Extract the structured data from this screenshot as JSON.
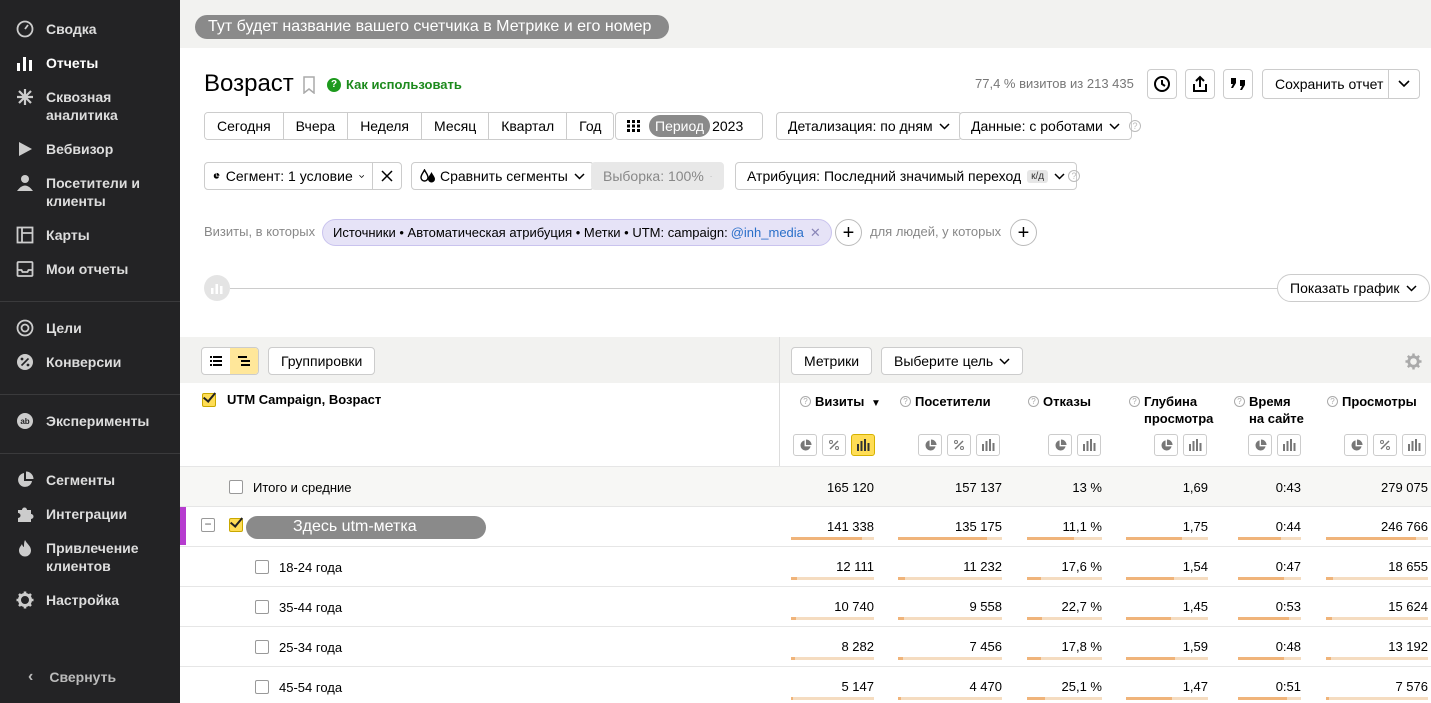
{
  "sidebar": {
    "items": [
      {
        "label": "Сводка",
        "icon": "dashboard-icon"
      },
      {
        "label": "Отчеты",
        "icon": "reports-icon"
      },
      {
        "label": "Сквозная аналитика",
        "icon": "end-to-end-icon"
      },
      {
        "label": "Вебвизор",
        "icon": "play-icon"
      },
      {
        "label": "Посетители и клиенты",
        "icon": "person-icon"
      },
      {
        "label": "Карты",
        "icon": "map-icon"
      },
      {
        "label": "Мои отчеты",
        "icon": "inbox-icon"
      },
      {
        "label": "Цели",
        "icon": "target-icon"
      },
      {
        "label": "Конверсии",
        "icon": "percent-icon"
      },
      {
        "label": "Эксперименты",
        "icon": "ab-icon"
      },
      {
        "label": "Сегменты",
        "icon": "pie-icon"
      },
      {
        "label": "Интеграции",
        "icon": "puzzle-icon"
      },
      {
        "label": "Привлечение клиентов",
        "icon": "fire-icon"
      },
      {
        "label": "Настройка",
        "icon": "gear-icon"
      }
    ],
    "active_index": 1,
    "collapse_label": "Свернуть"
  },
  "topbar": {
    "counter_placeholder": "Тут будет название вашего счетчика в Метрике и его номер"
  },
  "header": {
    "title": "Возраст",
    "howto_label": "Как использовать",
    "visits_info": "77,4 % визитов из 213 435",
    "save_label": "Сохранить отчет"
  },
  "periods": [
    "Сегодня",
    "Вчера",
    "Неделя",
    "Месяц",
    "Квартал",
    "Год"
  ],
  "controls": {
    "period_pill": "Период",
    "period_tail": "2023",
    "detail": "Детализация: по дням",
    "data": "Данные: с роботами",
    "segment": "Сегмент: 1 условие",
    "compare": "Сравнить сегменты",
    "sample": "Выборка: 100%",
    "attribution": "Атрибуция: Последний значимый переход",
    "attribution_badge": "к/д"
  },
  "filters": {
    "visits_label": "Визиты, в которых",
    "chip_text": "Источники • Автоматическая атрибуция • Метки • UTM: campaign:",
    "chip_link": "@inh_media",
    "people_label": "для людей, у которых"
  },
  "graph": {
    "show_label": "Показать график"
  },
  "table": {
    "groupings_label": "Группировки",
    "metrics_label": "Метрики",
    "goal_label": "Выберите цель",
    "dimension_header": "UTM Campaign, Возраст",
    "columns": [
      {
        "line1": "Визиты",
        "line2": "",
        "sort": "▼"
      },
      {
        "line1": "Посетители",
        "line2": "",
        "sort": ""
      },
      {
        "line1": "Отказы",
        "line2": "",
        "sort": ""
      },
      {
        "line1": "Глубина",
        "line2": "просмотра",
        "sort": ""
      },
      {
        "line1": "Время",
        "line2": "на сайте",
        "sort": ""
      },
      {
        "line1": "Просмотры",
        "line2": "",
        "sort": ""
      }
    ],
    "total": {
      "label": "Итого и средние",
      "values": [
        "165 120",
        "157 137",
        "13 %",
        "1,69",
        "0:43",
        "279 075"
      ]
    },
    "campaign": {
      "label": "Здесь utm-метка",
      "values": [
        "141 338",
        "135 175",
        "11,1 %",
        "1,75",
        "0:44",
        "246 766"
      ],
      "bars": [
        0.86,
        0.86,
        0.63,
        0.68,
        0.68,
        0.88
      ]
    },
    "rows": [
      {
        "label": "18-24 года",
        "values": [
          "12 111",
          "11 232",
          "17,6 %",
          "1,54",
          "0:47",
          "18 655"
        ],
        "bars": [
          0.07,
          0.07,
          0.18,
          0.58,
          0.73,
          0.07
        ]
      },
      {
        "label": "35-44 года",
        "values": [
          "10 740",
          "9 558",
          "22,7 %",
          "1,45",
          "0:53",
          "15 624"
        ],
        "bars": [
          0.06,
          0.06,
          0.2,
          0.55,
          0.81,
          0.06
        ]
      },
      {
        "label": "25-34 года",
        "values": [
          "8 282",
          "7 456",
          "17,8 %",
          "1,59",
          "0:48",
          "13 192"
        ],
        "bars": [
          0.05,
          0.05,
          0.18,
          0.6,
          0.73,
          0.05
        ]
      },
      {
        "label": "45-54 года",
        "values": [
          "5 147",
          "4 470",
          "25,1 %",
          "1,47",
          "0:51",
          "7 576"
        ],
        "bars": [
          0.03,
          0.03,
          0.24,
          0.56,
          0.78,
          0.03
        ]
      }
    ]
  }
}
